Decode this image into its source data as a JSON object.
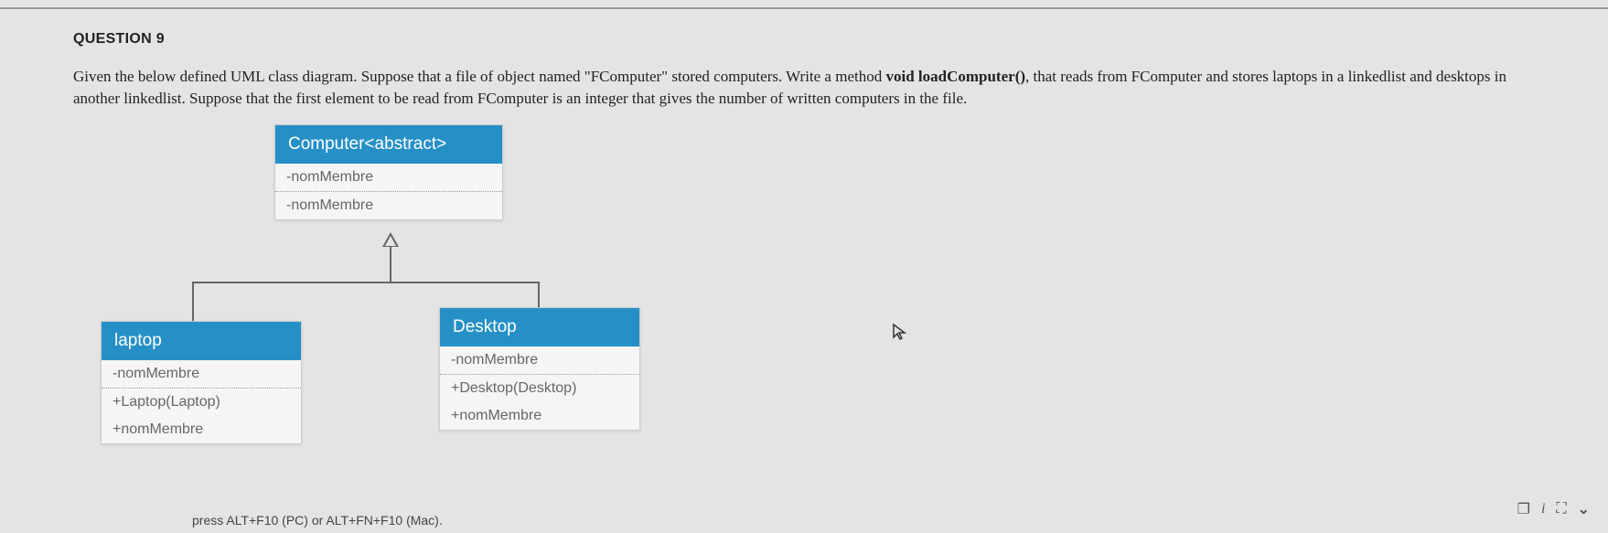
{
  "question": {
    "title": "QUESTION 9",
    "text_part1": "Given the below defined UML class diagram. Suppose that a file of object named \"FComputer\" stored computers. Write a method ",
    "text_bold": "void loadComputer()",
    "text_part2": ", that reads from FComputer and stores laptops in a linkedlist and desktops in another linkedlist. Suppose that the first element to be read from FComputer is an integer that gives the number of written computers in the file."
  },
  "uml": {
    "computer": {
      "title": "Computer<abstract>",
      "row1": "-nomMembre",
      "row2": "-nomMembre"
    },
    "laptop": {
      "title": "laptop",
      "row1": "-nomMembre",
      "row2": "+Laptop(Laptop)",
      "row3": "+nomMembre"
    },
    "desktop": {
      "title": "Desktop",
      "row1": "-nomMembre",
      "row2": "+Desktop(Desktop)",
      "row3": "+nomMembre"
    }
  },
  "hint": "press ALT+F10 (PC) or ALT+FN+F10 (Mac).",
  "icons": {
    "screen": "❐",
    "info": "i",
    "expand": "⛶",
    "chevron": "⌄"
  }
}
